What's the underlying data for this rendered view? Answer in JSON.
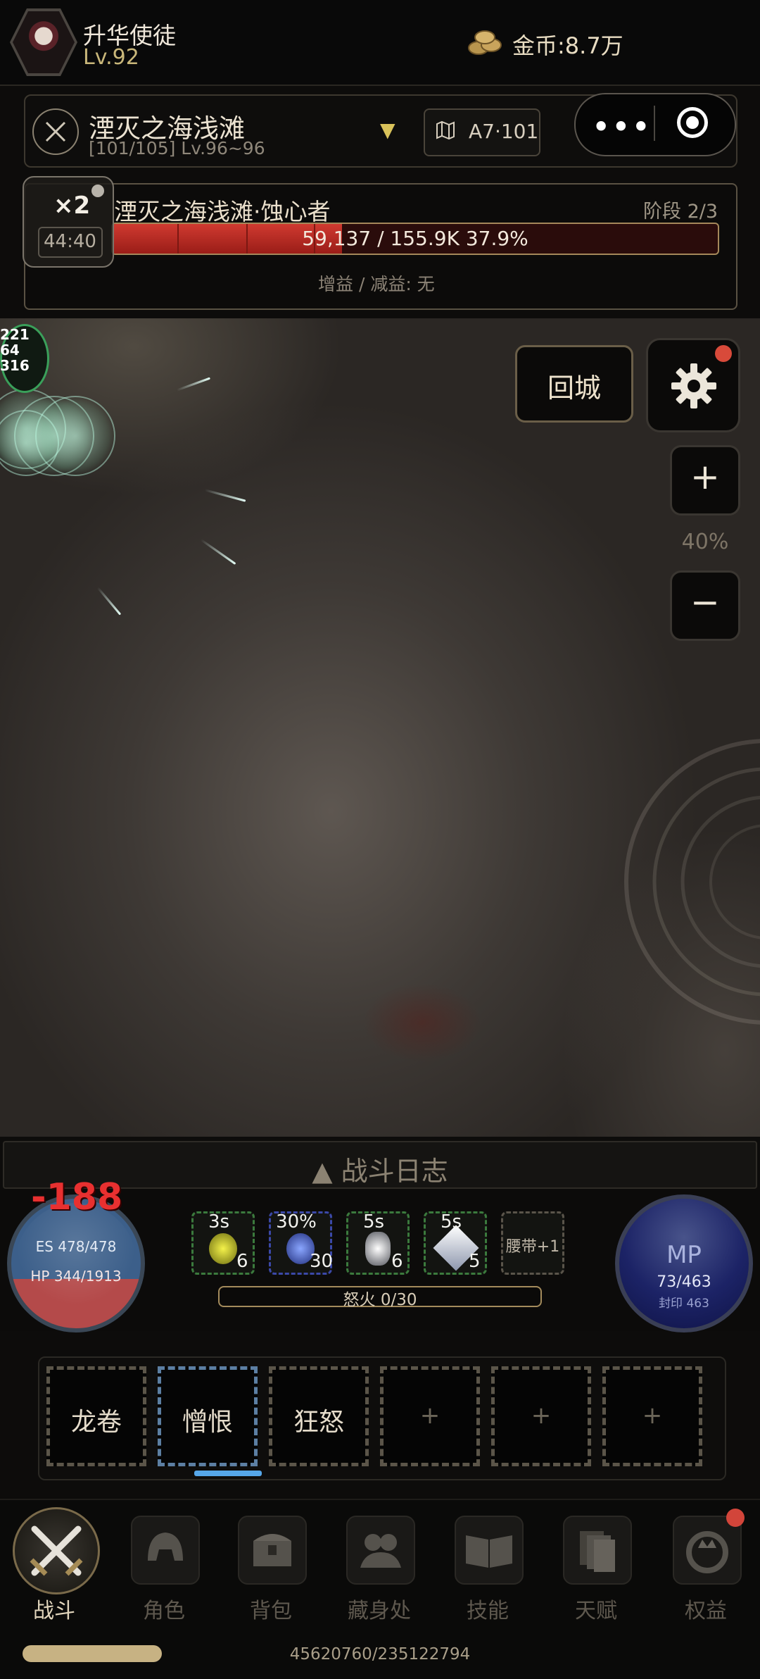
{
  "player": {
    "name": "升华使徒",
    "level": "Lv.92",
    "gold": "金币:8.7万"
  },
  "zone": {
    "name": "湮灭之海浅滩",
    "sub": "[101/105] Lv.96~96",
    "map_code": "A7·101",
    "dropdown_glyph": "▼"
  },
  "mini_program": {
    "menu_glyph": "•••"
  },
  "boss": {
    "name": "湮灭之海浅滩·蚀心者",
    "stage": "阶段 2/3",
    "hp_text": "59,137 / 155.9K   37.9%",
    "hp_fraction": 0.379,
    "buff": "增益 / 减益: 无"
  },
  "speed": {
    "multiplier": "×2",
    "timer": "44:40"
  },
  "battlefield": {
    "mob_badge": "221\n64\n316"
  },
  "controls": {
    "town_label": "回城",
    "zoom_in": "+",
    "zoom_level": "40%",
    "zoom_out": "−"
  },
  "battle_log": {
    "label": "▲ 战斗日志"
  },
  "hud": {
    "damage": "-188",
    "es": "ES 478/478",
    "hp": "HP 344/1913",
    "mp_label": "MP",
    "mp": "73/463",
    "seal": "封印 463",
    "rage": "怒火 0/30",
    "belt": "腰带+1",
    "flasks": [
      {
        "cd": "3s",
        "count": "6",
        "color": "#c8c93a"
      },
      {
        "cd": "30%",
        "count": "30",
        "color": "#3a56c0"
      },
      {
        "cd": "5s",
        "count": "6",
        "color": "#c9c9c9"
      },
      {
        "cd": "5s",
        "count": "5",
        "color": "#cfd6e6"
      }
    ]
  },
  "skills": [
    {
      "label": "龙卷"
    },
    {
      "label": "憎恨"
    },
    {
      "label": "狂怒"
    },
    {
      "label": "+"
    },
    {
      "label": "+"
    },
    {
      "label": "+"
    }
  ],
  "nav": {
    "items": [
      {
        "label": "战斗",
        "icon": "swords-icon"
      },
      {
        "label": "角色",
        "icon": "helmet-icon"
      },
      {
        "label": "背包",
        "icon": "chest-icon"
      },
      {
        "label": "藏身处",
        "icon": "hideout-icon"
      },
      {
        "label": "技能",
        "icon": "book-icon"
      },
      {
        "label": "天赋",
        "icon": "cards-icon"
      },
      {
        "label": "权益",
        "icon": "crown-icon"
      }
    ],
    "exp_text": "45620760/235122794",
    "exp_fraction": 0.194
  }
}
